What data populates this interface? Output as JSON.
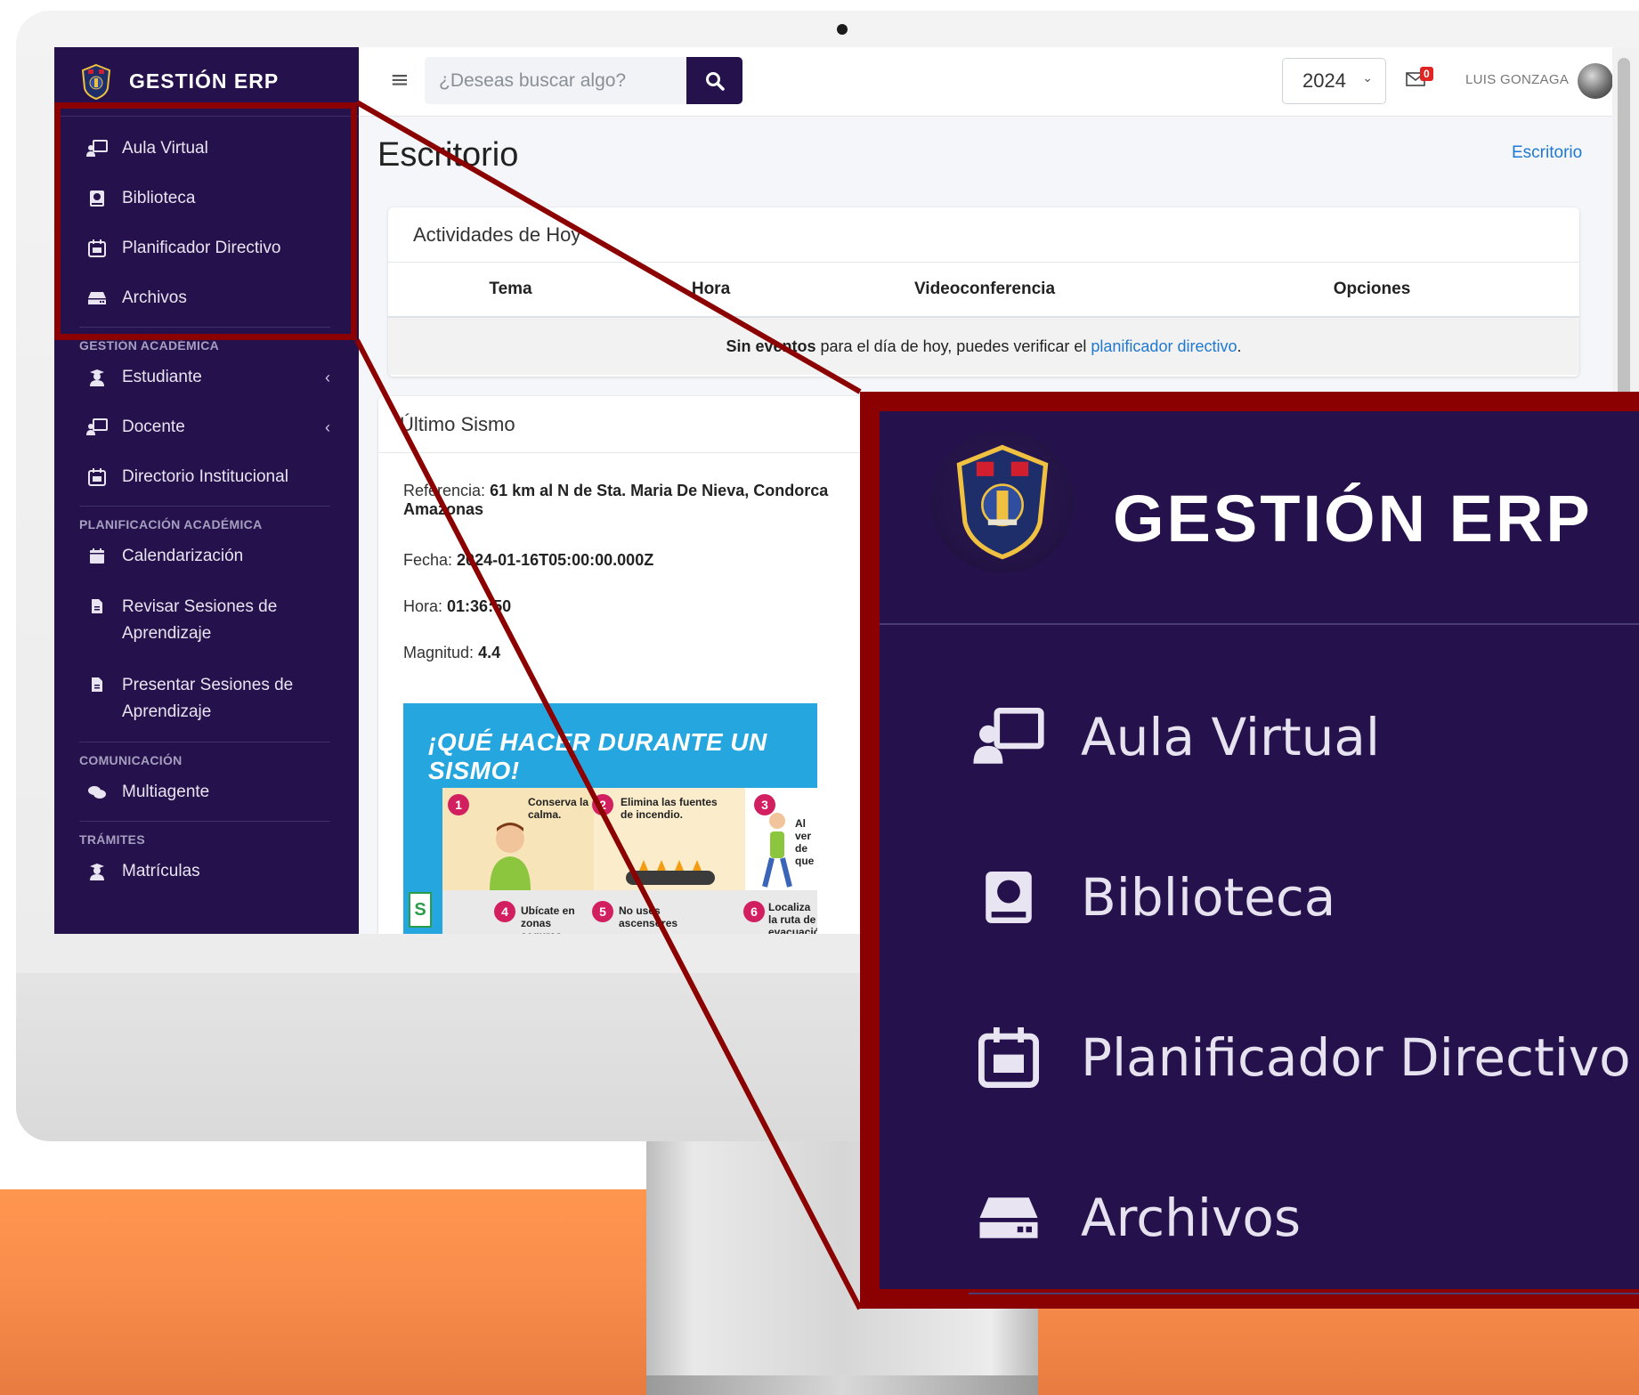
{
  "sidebar": {
    "brand": "GESTIÓN ERP",
    "top_items": [
      {
        "label": "Aula Virtual",
        "icon": "chalkboard-teacher-icon"
      },
      {
        "label": "Biblioteca",
        "icon": "book-icon"
      },
      {
        "label": "Planificador Directivo",
        "icon": "calendar-icon"
      },
      {
        "label": "Archivos",
        "icon": "hdd-icon"
      }
    ],
    "sections": [
      {
        "title": "GESTIÓN ACADÉMICA",
        "items": [
          {
            "label": "Estudiante",
            "icon": "user-graduate-icon",
            "chevron": "‹"
          },
          {
            "label": "Docente",
            "icon": "chalkboard-teacher-icon",
            "chevron": "‹"
          },
          {
            "label": "Directorio Institucional",
            "icon": "calendar-icon"
          }
        ]
      },
      {
        "title": "PLANIFICACIÓN ACADÉMICA",
        "items": [
          {
            "label": "Calendarización",
            "icon": "calendar-alt-icon"
          },
          {
            "label": "Revisar Sesiones de Aprendizaje",
            "icon": "file-icon"
          },
          {
            "label": "Presentar Sesiones de Aprendizaje",
            "icon": "file-icon"
          }
        ]
      },
      {
        "title": "COMUNICACIÓN",
        "items": [
          {
            "label": "Multiagente",
            "icon": "comments-icon"
          }
        ]
      },
      {
        "title": "TRÁMITES",
        "items": [
          {
            "label": "Matrículas",
            "icon": "user-graduate-icon"
          }
        ]
      }
    ]
  },
  "topbar": {
    "search_placeholder": "¿Deseas buscar algo?",
    "year": "2024",
    "mail_count": "0",
    "user_name": "LUIS GONZAGA"
  },
  "page": {
    "title": "Escritorio",
    "breadcrumb": "Escritorio"
  },
  "activities": {
    "title": "Actividades de Hoy",
    "columns": [
      "Tema",
      "Hora",
      "Videoconferencia",
      "Opciones"
    ],
    "empty_bold": "Sin eventos",
    "empty_text": "para el día de hoy, puedes verificar el",
    "empty_link": "planificador directivo",
    "empty_end": "."
  },
  "sismo": {
    "title": "Último Sismo",
    "referencia_label": "Referencia:",
    "referencia_value": "61 km al N de Sta. Maria De Nieva, Condorca",
    "referencia_value2": "Amazonas",
    "fecha_label": "Fecha:",
    "fecha_value": "2024-01-16T05:00:00.000Z",
    "hora_label": "Hora:",
    "hora_value": "01:36:50",
    "magnitud_label": "Magnitud:",
    "magnitud_value": "4.4",
    "poster": {
      "title": "¡QUÉ HACER DURANTE UN SISMO!",
      "steps": [
        {
          "num": "1",
          "text": "Conserva la calma."
        },
        {
          "num": "2",
          "text": "Elimina las fuentes de incendio."
        },
        {
          "num": "3",
          "text": "Al ver de que"
        },
        {
          "num": "4",
          "text": "Ubícate en zonas seguras."
        },
        {
          "num": "5",
          "text": "No uses ascensores"
        },
        {
          "num": "6",
          "text": "Localiza la ruta de evacuación."
        }
      ]
    }
  },
  "zoom": {
    "brand": "GESTIÓN ERP",
    "items": [
      {
        "label": "Aula Virtual"
      },
      {
        "label": "Biblioteca"
      },
      {
        "label": "Planificador Directivo"
      },
      {
        "label": "Archivos"
      }
    ]
  },
  "colors": {
    "sidebar_bg": "#25114b",
    "accent_dark_red": "#8b0000",
    "link_blue": "#1f78d1",
    "floor_orange": "#ff964f"
  }
}
